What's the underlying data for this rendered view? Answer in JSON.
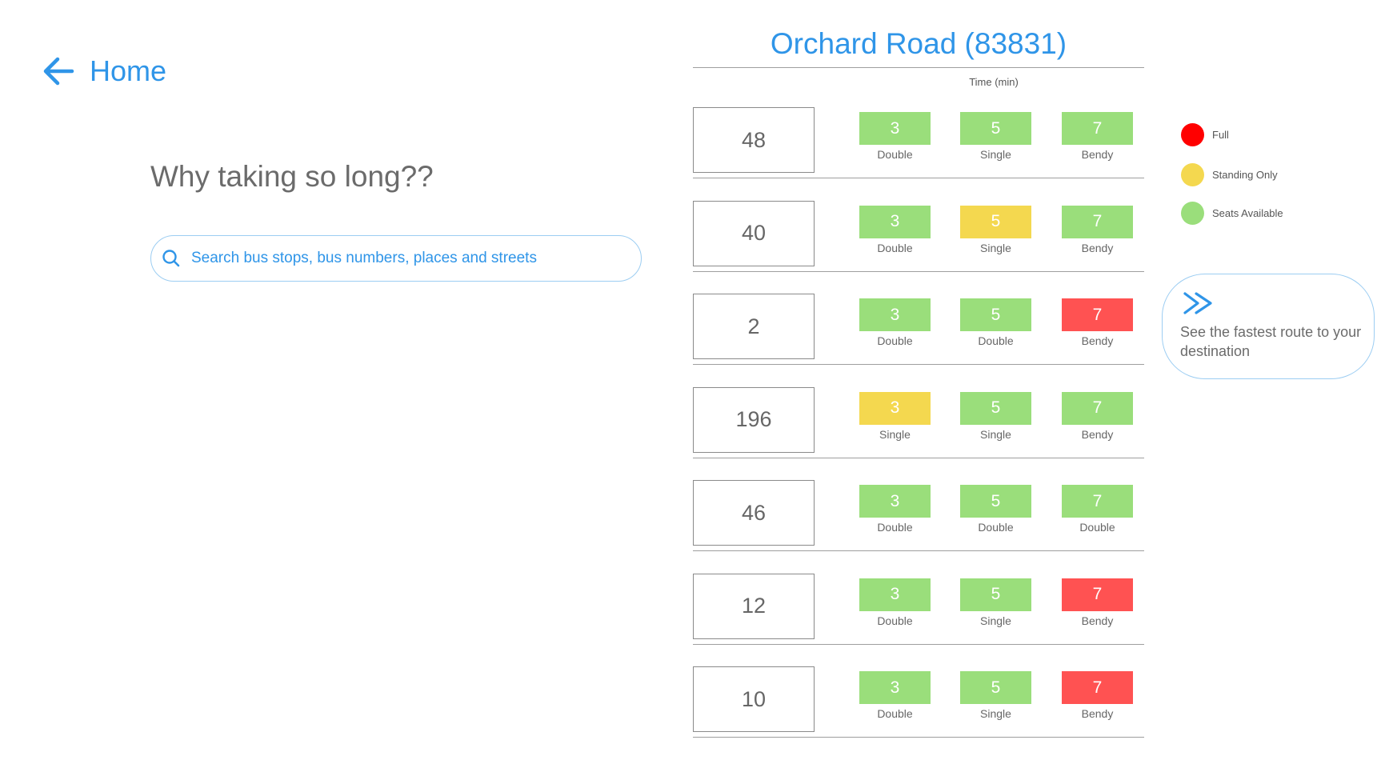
{
  "colors": {
    "accent": "#2f95e8",
    "full": "#ff5252",
    "standing": "#f4d84f",
    "seats": "#9ade7b",
    "full_dot": "#ff0000"
  },
  "nav": {
    "back_label": "Home",
    "back_icon": "arrow-left-icon"
  },
  "question": "Why taking so long??",
  "search": {
    "placeholder": "Search bus stops, bus numbers, places and streets",
    "value": "",
    "icon": "search-icon"
  },
  "stop": {
    "title": "Orchard Road (83831)"
  },
  "time_header": "Time (min)",
  "buses": [
    {
      "number": "48",
      "arrivals": [
        {
          "time": "3",
          "type": "Double",
          "status": "seats"
        },
        {
          "time": "5",
          "type": "Single",
          "status": "seats"
        },
        {
          "time": "7",
          "type": "Bendy",
          "status": "seats"
        }
      ]
    },
    {
      "number": "40",
      "arrivals": [
        {
          "time": "3",
          "type": "Double",
          "status": "seats"
        },
        {
          "time": "5",
          "type": "Single",
          "status": "standing"
        },
        {
          "time": "7",
          "type": "Bendy",
          "status": "seats"
        }
      ]
    },
    {
      "number": "2",
      "arrivals": [
        {
          "time": "3",
          "type": "Double",
          "status": "seats"
        },
        {
          "time": "5",
          "type": "Double",
          "status": "seats"
        },
        {
          "time": "7",
          "type": "Bendy",
          "status": "full"
        }
      ]
    },
    {
      "number": "196",
      "arrivals": [
        {
          "time": "3",
          "type": "Single",
          "status": "standing"
        },
        {
          "time": "5",
          "type": "Single",
          "status": "seats"
        },
        {
          "time": "7",
          "type": "Bendy",
          "status": "seats"
        }
      ]
    },
    {
      "number": "46",
      "arrivals": [
        {
          "time": "3",
          "type": "Double",
          "status": "seats"
        },
        {
          "time": "5",
          "type": "Double",
          "status": "seats"
        },
        {
          "time": "7",
          "type": "Double",
          "status": "seats"
        }
      ]
    },
    {
      "number": "12",
      "arrivals": [
        {
          "time": "3",
          "type": "Double",
          "status": "seats"
        },
        {
          "time": "5",
          "type": "Single",
          "status": "seats"
        },
        {
          "time": "7",
          "type": "Bendy",
          "status": "full"
        }
      ]
    },
    {
      "number": "10",
      "arrivals": [
        {
          "time": "3",
          "type": "Double",
          "status": "seats"
        },
        {
          "time": "5",
          "type": "Single",
          "status": "seats"
        },
        {
          "time": "7",
          "type": "Bendy",
          "status": "full"
        }
      ]
    }
  ],
  "legend": [
    {
      "key": "full",
      "label": "Full"
    },
    {
      "key": "standing",
      "label": "Standing Only"
    },
    {
      "key": "seats",
      "label": "Seats Available"
    }
  ],
  "route_card": {
    "text": "See the fastest route to your destination",
    "icon": "double-chevron-right-icon"
  }
}
